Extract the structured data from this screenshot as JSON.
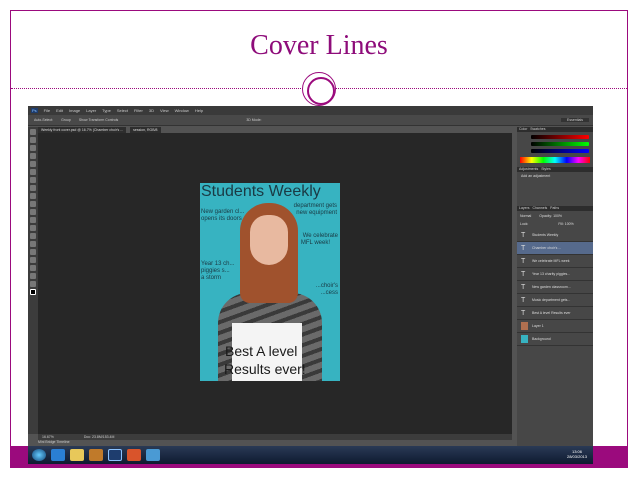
{
  "slide": {
    "title": "Cover Lines",
    "accent": "#9b0a7d"
  },
  "ps": {
    "menu": [
      "File",
      "Edit",
      "Image",
      "Layer",
      "Type",
      "Select",
      "Filter",
      "3D",
      "View",
      "Window",
      "Help"
    ],
    "options": {
      "auto_select": "Auto-Select:",
      "group": "Group",
      "transform": "Show Transform Controls",
      "mode": "3D Mode:",
      "workspace": "Essentials"
    },
    "tabs": [
      "Weekly front cover.psd @ 16.7% (Chamber choir's ...",
      "session, RGB/8"
    ],
    "status": {
      "zoom": "16.67%",
      "doc": "Doc: 23.8M/153.4M"
    },
    "minibridge": "Mini Bridge  Timeline",
    "panels": {
      "color": "Color",
      "swatches": "Swatches",
      "adjustments": "Adjustments",
      "styles": "Styles",
      "add_adjustment": "Add an adjustment",
      "layers": "Layers",
      "channels": "Channels",
      "paths": "Paths",
      "blend": "Normal",
      "opacity": "Opacity: 100%",
      "fill": "Fill: 100%",
      "lock": "Lock:"
    },
    "layers": [
      {
        "name": "Students Weekly",
        "type": "text"
      },
      {
        "name": "Chamber choir's ...",
        "type": "text",
        "selected": true
      },
      {
        "name": "We celebrate MFL week",
        "type": "text"
      },
      {
        "name": "Year 13 charity piggies...",
        "type": "text"
      },
      {
        "name": "New garden classroom...",
        "type": "text"
      },
      {
        "name": "Music department gets...",
        "type": "text"
      },
      {
        "name": "Best A level Results ever",
        "type": "text"
      },
      {
        "name": "Layer 1",
        "type": "image"
      },
      {
        "name": "Background",
        "type": "fill"
      }
    ]
  },
  "cover": {
    "masthead": "Students Weekly",
    "line1": "department gets",
    "line1b": "new equipment",
    "line2": "New garden cl...",
    "line2b": "opens its doors",
    "line3": "We celebrate",
    "line3b": "MFL week!",
    "line4": "Year 13 ch...",
    "line4b": "piggies s...",
    "line4c": "a storm",
    "line5": "...choir's",
    "line5b": "...cess",
    "headline1": "Best A level",
    "headline2": "Results ever!"
  },
  "taskbar": {
    "time": "13:06",
    "date": "28/03/2013"
  }
}
